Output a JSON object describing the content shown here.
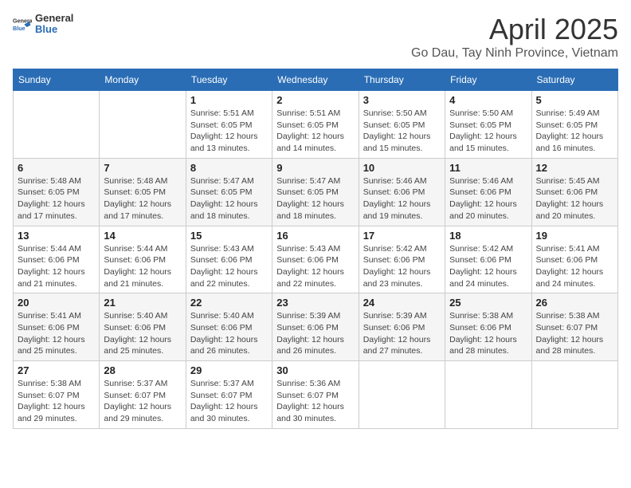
{
  "logo": {
    "text_general": "General",
    "text_blue": "Blue"
  },
  "title": "April 2025",
  "location": "Go Dau, Tay Ninh Province, Vietnam",
  "weekdays": [
    "Sunday",
    "Monday",
    "Tuesday",
    "Wednesday",
    "Thursday",
    "Friday",
    "Saturday"
  ],
  "weeks": [
    [
      {
        "day": "",
        "info": ""
      },
      {
        "day": "",
        "info": ""
      },
      {
        "day": "1",
        "info": "Sunrise: 5:51 AM\nSunset: 6:05 PM\nDaylight: 12 hours and 13 minutes."
      },
      {
        "day": "2",
        "info": "Sunrise: 5:51 AM\nSunset: 6:05 PM\nDaylight: 12 hours and 14 minutes."
      },
      {
        "day": "3",
        "info": "Sunrise: 5:50 AM\nSunset: 6:05 PM\nDaylight: 12 hours and 15 minutes."
      },
      {
        "day": "4",
        "info": "Sunrise: 5:50 AM\nSunset: 6:05 PM\nDaylight: 12 hours and 15 minutes."
      },
      {
        "day": "5",
        "info": "Sunrise: 5:49 AM\nSunset: 6:05 PM\nDaylight: 12 hours and 16 minutes."
      }
    ],
    [
      {
        "day": "6",
        "info": "Sunrise: 5:48 AM\nSunset: 6:05 PM\nDaylight: 12 hours and 17 minutes."
      },
      {
        "day": "7",
        "info": "Sunrise: 5:48 AM\nSunset: 6:05 PM\nDaylight: 12 hours and 17 minutes."
      },
      {
        "day": "8",
        "info": "Sunrise: 5:47 AM\nSunset: 6:05 PM\nDaylight: 12 hours and 18 minutes."
      },
      {
        "day": "9",
        "info": "Sunrise: 5:47 AM\nSunset: 6:05 PM\nDaylight: 12 hours and 18 minutes."
      },
      {
        "day": "10",
        "info": "Sunrise: 5:46 AM\nSunset: 6:06 PM\nDaylight: 12 hours and 19 minutes."
      },
      {
        "day": "11",
        "info": "Sunrise: 5:46 AM\nSunset: 6:06 PM\nDaylight: 12 hours and 20 minutes."
      },
      {
        "day": "12",
        "info": "Sunrise: 5:45 AM\nSunset: 6:06 PM\nDaylight: 12 hours and 20 minutes."
      }
    ],
    [
      {
        "day": "13",
        "info": "Sunrise: 5:44 AM\nSunset: 6:06 PM\nDaylight: 12 hours and 21 minutes."
      },
      {
        "day": "14",
        "info": "Sunrise: 5:44 AM\nSunset: 6:06 PM\nDaylight: 12 hours and 21 minutes."
      },
      {
        "day": "15",
        "info": "Sunrise: 5:43 AM\nSunset: 6:06 PM\nDaylight: 12 hours and 22 minutes."
      },
      {
        "day": "16",
        "info": "Sunrise: 5:43 AM\nSunset: 6:06 PM\nDaylight: 12 hours and 22 minutes."
      },
      {
        "day": "17",
        "info": "Sunrise: 5:42 AM\nSunset: 6:06 PM\nDaylight: 12 hours and 23 minutes."
      },
      {
        "day": "18",
        "info": "Sunrise: 5:42 AM\nSunset: 6:06 PM\nDaylight: 12 hours and 24 minutes."
      },
      {
        "day": "19",
        "info": "Sunrise: 5:41 AM\nSunset: 6:06 PM\nDaylight: 12 hours and 24 minutes."
      }
    ],
    [
      {
        "day": "20",
        "info": "Sunrise: 5:41 AM\nSunset: 6:06 PM\nDaylight: 12 hours and 25 minutes."
      },
      {
        "day": "21",
        "info": "Sunrise: 5:40 AM\nSunset: 6:06 PM\nDaylight: 12 hours and 25 minutes."
      },
      {
        "day": "22",
        "info": "Sunrise: 5:40 AM\nSunset: 6:06 PM\nDaylight: 12 hours and 26 minutes."
      },
      {
        "day": "23",
        "info": "Sunrise: 5:39 AM\nSunset: 6:06 PM\nDaylight: 12 hours and 26 minutes."
      },
      {
        "day": "24",
        "info": "Sunrise: 5:39 AM\nSunset: 6:06 PM\nDaylight: 12 hours and 27 minutes."
      },
      {
        "day": "25",
        "info": "Sunrise: 5:38 AM\nSunset: 6:06 PM\nDaylight: 12 hours and 28 minutes."
      },
      {
        "day": "26",
        "info": "Sunrise: 5:38 AM\nSunset: 6:07 PM\nDaylight: 12 hours and 28 minutes."
      }
    ],
    [
      {
        "day": "27",
        "info": "Sunrise: 5:38 AM\nSunset: 6:07 PM\nDaylight: 12 hours and 29 minutes."
      },
      {
        "day": "28",
        "info": "Sunrise: 5:37 AM\nSunset: 6:07 PM\nDaylight: 12 hours and 29 minutes."
      },
      {
        "day": "29",
        "info": "Sunrise: 5:37 AM\nSunset: 6:07 PM\nDaylight: 12 hours and 30 minutes."
      },
      {
        "day": "30",
        "info": "Sunrise: 5:36 AM\nSunset: 6:07 PM\nDaylight: 12 hours and 30 minutes."
      },
      {
        "day": "",
        "info": ""
      },
      {
        "day": "",
        "info": ""
      },
      {
        "day": "",
        "info": ""
      }
    ]
  ]
}
